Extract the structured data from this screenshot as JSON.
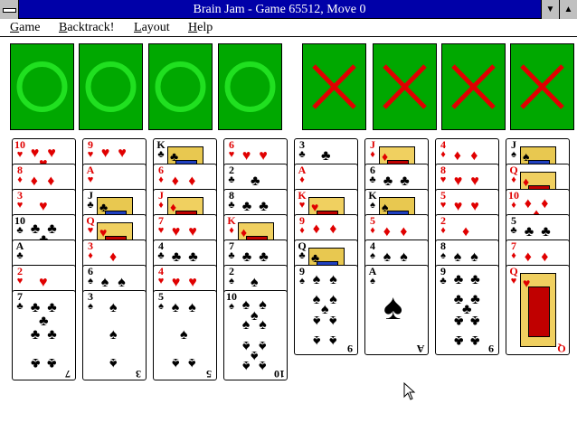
{
  "window": {
    "title": "Brain Jam - Game 65512, Move 0",
    "minimize_icon": "triangle-down",
    "maximize_icon": "triangle-up"
  },
  "menu": [
    {
      "label": "Game",
      "underline": "G",
      "rest": "ame"
    },
    {
      "label": "Backtrack!",
      "underline": "B",
      "rest": "acktrack!"
    },
    {
      "label": "Layout",
      "underline": "L",
      "rest": "ayout"
    },
    {
      "label": "Help",
      "underline": "H",
      "rest": "elp"
    }
  ],
  "colors": {
    "slot_green": "#00a800",
    "ring_green": "#20e020",
    "x_red": "#e00000",
    "title_blue": "#0000a8"
  },
  "foundations": [
    {
      "symbol": "O"
    },
    {
      "symbol": "O"
    },
    {
      "symbol": "O"
    },
    {
      "symbol": "O"
    },
    {
      "symbol": "X"
    },
    {
      "symbol": "X"
    },
    {
      "symbol": "X"
    },
    {
      "symbol": "X"
    }
  ],
  "tableau": [
    [
      "10♥",
      "8♦",
      "3♥",
      "10♣",
      "A♣",
      "2♥",
      "7♣"
    ],
    [
      "9♥",
      "A♥",
      "J♣",
      "Q♥",
      "3♦",
      "6♠",
      "3♠"
    ],
    [
      "K♣",
      "6♦",
      "J♦",
      "7♥",
      "4♣",
      "4♥",
      "5♠"
    ],
    [
      "6♥",
      "2♣",
      "8♣",
      "K♦",
      "7♣",
      "2♠",
      "10♠"
    ],
    [
      "3♣",
      "A♦",
      "K♥",
      "9♦",
      "Q♣",
      "9♠"
    ],
    [
      "J♦",
      "6♣",
      "K♠",
      "5♦",
      "4♠",
      "A♠"
    ],
    [
      "4♦",
      "8♥",
      "5♥",
      "2♦",
      "8♠",
      "9♣"
    ],
    [
      "J♠",
      "Q♦",
      "10♦",
      "5♣",
      "7♦",
      "Q♥"
    ]
  ]
}
